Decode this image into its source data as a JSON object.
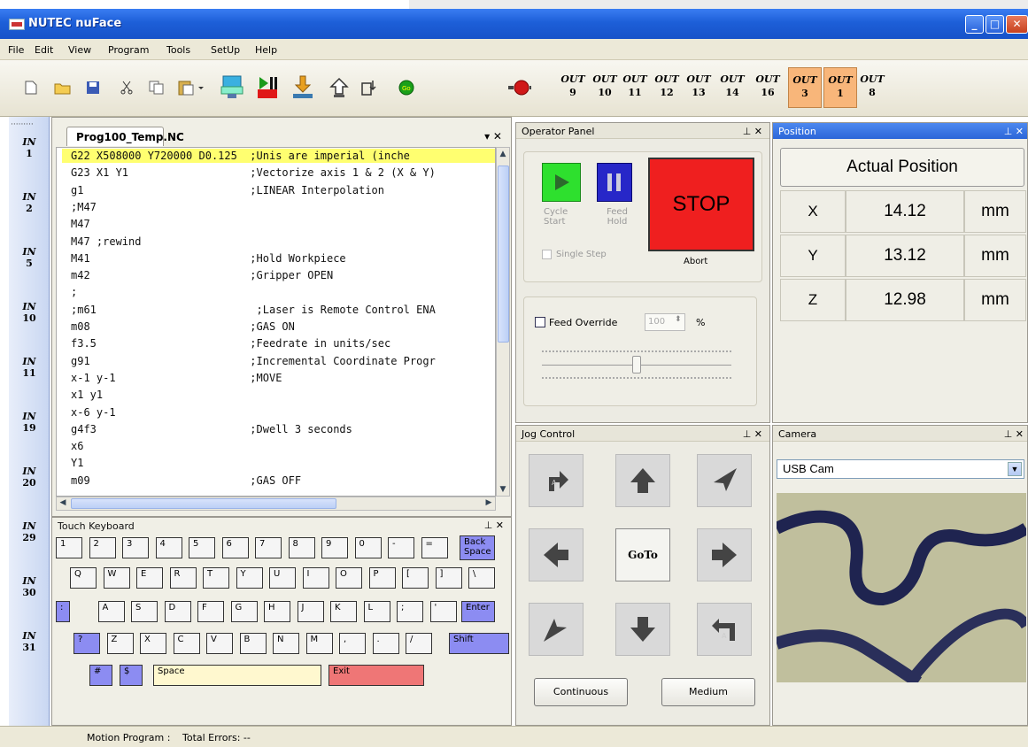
{
  "window": {
    "title": "NUTEC nuFace"
  },
  "menu": [
    "File",
    "Edit",
    "View",
    "Program",
    "Tools",
    "SetUp",
    "Help"
  ],
  "outputs": [
    {
      "label": "OUT",
      "num": "9",
      "active": false
    },
    {
      "label": "OUT",
      "num": "10",
      "active": false
    },
    {
      "label": "OUT",
      "num": "11",
      "active": false
    },
    {
      "label": "OUT",
      "num": "12",
      "active": false
    },
    {
      "label": "OUT",
      "num": "13",
      "active": false
    },
    {
      "label": "OUT",
      "num": "14",
      "active": false
    },
    {
      "label": "OUT",
      "num": "16",
      "active": false
    },
    {
      "label": "OUT",
      "num": "3",
      "active": true
    },
    {
      "label": "OUT",
      "num": "1",
      "active": true
    },
    {
      "label": "OUT",
      "num": "8",
      "active": false
    }
  ],
  "inputs": [
    {
      "label": "IN",
      "num": "1"
    },
    {
      "label": "IN",
      "num": "2"
    },
    {
      "label": "IN",
      "num": "5"
    },
    {
      "label": "IN",
      "num": "10"
    },
    {
      "label": "IN",
      "num": "11"
    },
    {
      "label": "IN",
      "num": "19"
    },
    {
      "label": "IN",
      "num": "20"
    },
    {
      "label": "IN",
      "num": "29"
    },
    {
      "label": "IN",
      "num": "30"
    },
    {
      "label": "IN",
      "num": "31"
    }
  ],
  "editor": {
    "tab": "Prog100_Temp.NC",
    "close": "▾ ✕",
    "lines": [
      "G22 X508000 Y720000 D0.125  ;Unis are imperial (inche",
      "G23 X1 Y1                   ;Vectorize axis 1 & 2 (X & Y)",
      "g1                          ;LINEAR Interpolation",
      ";M47",
      "M47",
      "M47 ;rewind",
      "M41                         ;Hold Workpiece",
      "m42                         ;Gripper OPEN",
      ";",
      ";m61                         ;Laser is Remote Control ENA",
      "m08                         ;GAS ON",
      "f3.5                        ;Feedrate in units/sec",
      "g91                         ;Incremental Coordinate Progr",
      "x-1 y-1                     ;MOVE",
      "x1 y1",
      "x-6 y-1",
      "g4f3                        ;Dwell 3 seconds",
      "x6",
      "Y1",
      "m09                         ;GAS OFF"
    ]
  },
  "keyboard": {
    "title": "Touch Keyboard",
    "row1": [
      "1",
      "2",
      "3",
      "4",
      "5",
      "6",
      "7",
      "8",
      "9",
      "0",
      "-",
      "=",
      "Back Space"
    ],
    "row2": [
      "Q",
      "W",
      "E",
      "R",
      "T",
      "Y",
      "U",
      "I",
      "O",
      "P",
      "[",
      "]",
      "\\"
    ],
    "row3": [
      ":",
      "A",
      "S",
      "D",
      "F",
      "G",
      "H",
      "J",
      "K",
      "L",
      ";",
      "'",
      "Enter"
    ],
    "row4": [
      "?",
      "Z",
      "X",
      "C",
      "V",
      "B",
      "N",
      "M",
      ",",
      ".",
      "/",
      "Shift"
    ],
    "row5": [
      "#",
      "$",
      "Space",
      "Exit"
    ]
  },
  "operator": {
    "title": "Operator Panel",
    "cycle_start": "Cycle Start",
    "feed_hold": "Feed Hold",
    "stop": "STOP",
    "abort": "Abort",
    "single_step": "Single Step",
    "feed_override": "Feed Override",
    "override_value": "100",
    "percent": "%",
    "slider_level": 0.5
  },
  "position": {
    "title": "Position",
    "header": "Actual Position",
    "axes": [
      {
        "axis": "X",
        "value": "14.12",
        "unit": "mm"
      },
      {
        "axis": "Y",
        "value": "13.12",
        "unit": "mm"
      },
      {
        "axis": "Z",
        "value": "12.98",
        "unit": "mm"
      }
    ]
  },
  "jog": {
    "title": "Jog Control",
    "goto": "GoTo",
    "continuous": "Continuous",
    "medium": "Medium",
    "cw_label": "A",
    "ccw_label": "A"
  },
  "camera": {
    "title": "Camera",
    "source": "USB Cam"
  },
  "panel_icons": {
    "pin": "pin-icon",
    "close": "close-icon"
  },
  "status": {
    "motion": "Motion Program :",
    "errors": "Total Errors: --"
  },
  "colors": {
    "titlebar": "#1d5fd8",
    "highlight": "#ffff70",
    "out_active": "#f8b67a",
    "stop": "#ef1f1f",
    "cycle": "#2ee02e",
    "hold": "#2727c8"
  }
}
